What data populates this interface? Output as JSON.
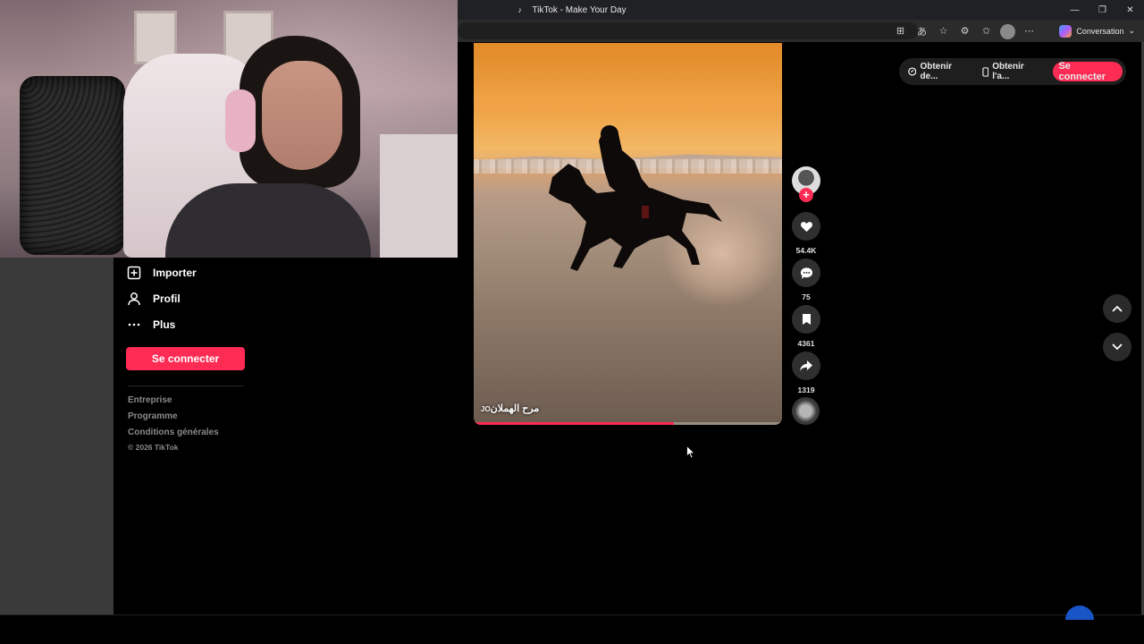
{
  "window": {
    "title": "TikTok - Make Your Day",
    "controls": {
      "minimize": "—",
      "restore": "❐",
      "close": "✕"
    }
  },
  "browser": {
    "conversation_label": "Conversation",
    "toolbar_icons": [
      "app-icon",
      "translate-icon",
      "favorite-star-icon",
      "extensions-icon",
      "favorites-icon",
      "profile-icon",
      "more-icon"
    ]
  },
  "sidebar": {
    "items": [
      {
        "label": "Importer",
        "icon": "upload-plus-icon"
      },
      {
        "label": "Profil",
        "icon": "person-icon"
      },
      {
        "label": "Plus",
        "icon": "more-dots-icon"
      }
    ],
    "login_label": "Se connecter",
    "footer_links": [
      "Entreprise",
      "Programme",
      "Conditions générales"
    ],
    "copyright": "© 2026 TikTok"
  },
  "video": {
    "caption": "مرح الهملان",
    "caption_suffix": "JO",
    "progress": 0.65
  },
  "actions": {
    "likes": "54.4K",
    "comments": "75",
    "saves": "4361",
    "shares": "1319"
  },
  "top_right": {
    "get_coins": "Obtenir de...",
    "get_app": "Obtenir l'a...",
    "login_label": "Se connecter"
  },
  "colors": {
    "accent": "#fe2c55",
    "background": "#000000"
  }
}
